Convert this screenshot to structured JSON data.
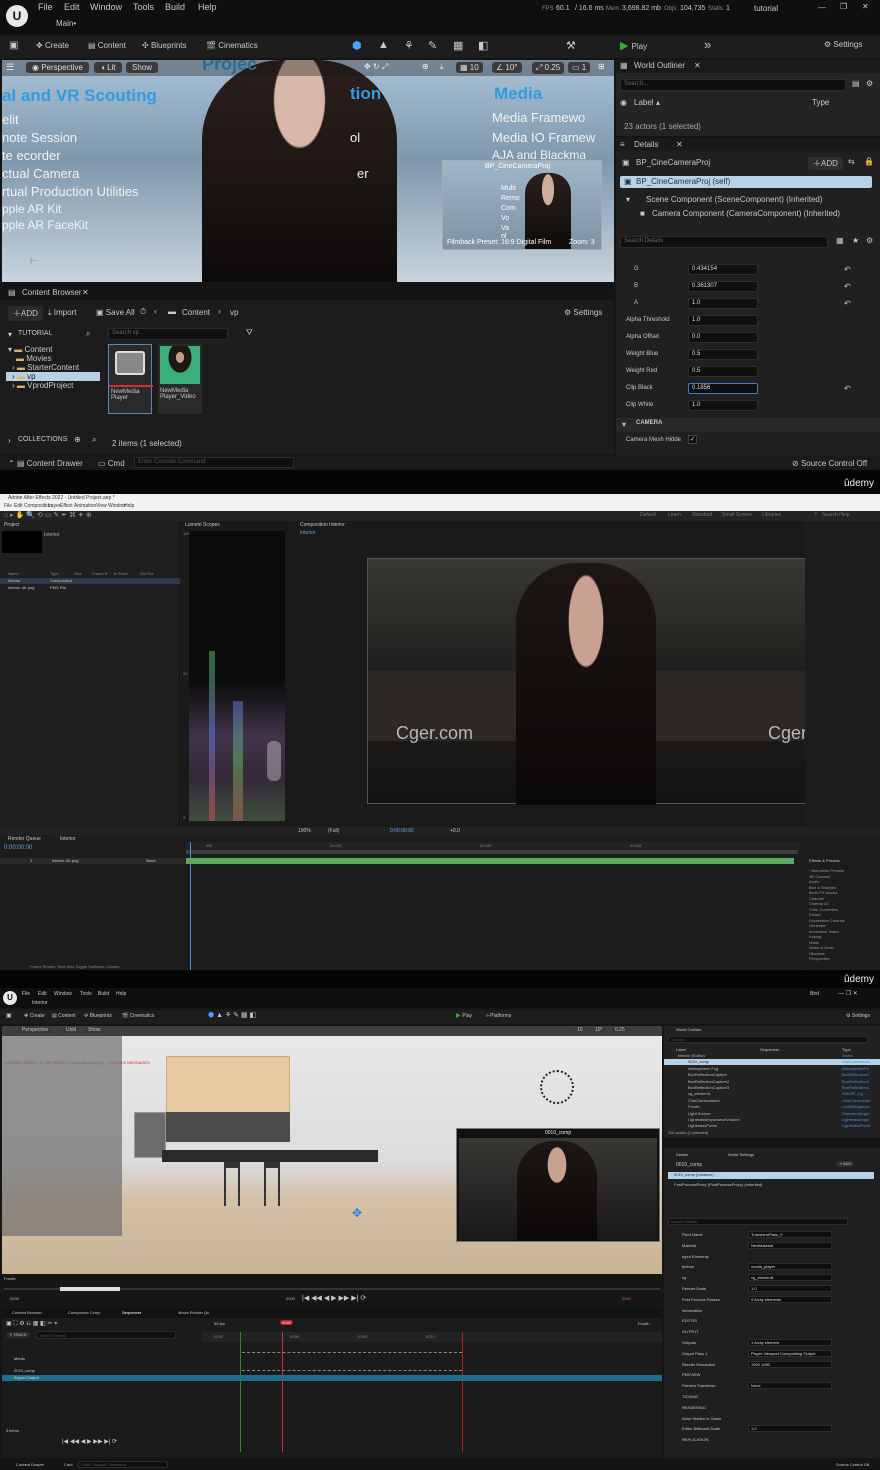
{
  "ue1": {
    "menu": [
      "File",
      "Edit",
      "Window",
      "Tools",
      "Build",
      "Help"
    ],
    "level_tab": "Main•",
    "stats": {
      "fps_label": "FPS",
      "fps": "60.1",
      "ms": "/ 16.6 ms",
      "mem_label": "Mem:",
      "mem": "3,698.82 mb",
      "objs_label": "Objs:",
      "objs": "104,735",
      "stalls_label": "Stalls:",
      "stalls": "1"
    },
    "project": "tutorial",
    "toolbar": {
      "create": "Create",
      "content": "Content",
      "blueprints": "Blueprints",
      "cinematics": "Cinematics",
      "play": "Play",
      "settings": "Settings"
    },
    "viewport": {
      "perspective": "Perspective",
      "lit": "Lit",
      "show": "Show",
      "snap": "10",
      "angle": "10°",
      "scale": "0.25",
      "cam": "1",
      "bg_left": [
        "al and VR Scouting",
        "elit",
        "note Session",
        "te ecorder",
        "ctual Camera",
        "rtual Production Utilities",
        "pple AR Kit",
        "pple AR FaceKit"
      ],
      "bg_top": "Projec",
      "bg_mid_a": "tion",
      "bg_mid_b": "ol",
      "bg_mid_c": "er",
      "bg_right": [
        "Media",
        "Media Framewo",
        "Media IO Framew",
        "AJA and Blackma"
      ],
      "pip_title": "BP_CineCameraProj",
      "pip_lines": [
        "Multi",
        "Remo",
        "Com",
        "Vo",
        "Va",
        "nl"
      ],
      "pip_preset": "Filmback Preset: 16:9 Digital Film",
      "pip_zoom": "Zoom: 3"
    },
    "outliner": {
      "title": "World Outliner",
      "search": "Search...",
      "col_label": "Label",
      "col_type": "Type",
      "count": "23 actors (1 selected)"
    },
    "details": {
      "title": "Details",
      "actor": "BP_CineCameraProj",
      "add": "ADD",
      "self": "BP_CineCameraProj (self)",
      "comp1": "Scene Component (SceneComponent) (Inherited)",
      "comp2": "Camera Component (CameraComponent) (Inherited)",
      "search": "Search Details",
      "props": [
        {
          "label": "G",
          "value": "0.434154"
        },
        {
          "label": "B",
          "value": "0.361307"
        },
        {
          "label": "A",
          "value": "1.0"
        },
        {
          "label": "Alpha Threshold",
          "value": "1.0"
        },
        {
          "label": "Alpha Offset",
          "value": "0.0"
        },
        {
          "label": "Weight Blue",
          "value": "0.5"
        },
        {
          "label": "Weight Red",
          "value": "0.5"
        },
        {
          "label": "Clip Black",
          "value": "0.1856"
        },
        {
          "label": "Clip White",
          "value": "1.0"
        }
      ],
      "section": "CAMERA",
      "camera_mesh": "Camera Mesh Hidde"
    },
    "content_browser": {
      "tab": "Content Browser",
      "add": "ADD",
      "import": "Import",
      "saveall": "Save All",
      "path1": "Content",
      "path2": "vp",
      "settings": "Settings",
      "project": "TUTORIAL",
      "search": "Search vp",
      "tree": [
        "Content",
        "Movies",
        "StarterContent",
        "vp",
        "VprodProject"
      ],
      "assets": [
        {
          "label": "NewMedia Player"
        },
        {
          "label": "NewMedia Player_Video"
        }
      ],
      "collections": "COLLECTIONS",
      "items": "2 items (1 selected)"
    },
    "statusbar": {
      "drawer": "Content Drawer",
      "cmd": "Cmd",
      "console": "Enter Console Command",
      "source": "Source Control Off"
    },
    "watermark": "ûdemy"
  },
  "ae": {
    "title": "Adobe After Effects 2022 - Untitled Project.aep *",
    "menu": [
      "File",
      "Edit",
      "Composition",
      "Layer",
      "Effect",
      "Animation",
      "View",
      "Window",
      "Help"
    ],
    "top_right": [
      "Default",
      "Learn",
      "Standard",
      "Small Screen",
      "Libraries"
    ],
    "search": "Search Help",
    "project_tab": "Project",
    "lumetri_tab": "Lumetri Scopes",
    "comp_tab": "Composition Interior",
    "comp_crumb": "Interior",
    "scope_ticks": [
      "100",
      "90",
      "80",
      "70",
      "60",
      "50",
      "40",
      "30",
      "20",
      "10",
      "0"
    ],
    "project_cols": [
      "Name",
      "Type",
      "Size",
      "Frame R",
      "In Point",
      "Out Poi"
    ],
    "project_rows": [
      {
        "name": "Interior",
        "type": "Composition"
      },
      {
        "name": "Interior-4K.png",
        "type": "PNG File"
      }
    ],
    "viewer_zoom": "100%",
    "viewer_res": "(Full)",
    "viewer_time": "0:00:00:00",
    "viewer_extra": "+0.0",
    "watermark_left": "Cger.com",
    "watermark_right": "Cger.com",
    "timeline_tab": "Interior",
    "render_tab": "Render Queue",
    "timecode": "0:00:00:00",
    "ruler": [
      "05f",
      "10f",
      "15f",
      "20f",
      "01:00f",
      "05f",
      "10f",
      "15f",
      "20f",
      "02:00f",
      "05f",
      "10f",
      "15f",
      "20f",
      "03:00f",
      "05f",
      "10f"
    ],
    "layer": {
      "num": "1",
      "name": "Interior-4K.png",
      "mode": "None"
    },
    "effects_title": "Effects & Presets",
    "effects": [
      "* Animation Presets",
      "3D Channel",
      "Audio",
      "Blur & Sharpen",
      "Boris FX Mocha",
      "Channel",
      "Cinema 4D",
      "Color Correction",
      "Distort",
      "Expression Controls",
      "Generate",
      "Immersive Video",
      "Keying",
      "Matte",
      "Noise & Grain",
      "Obsolete",
      "Perspective"
    ],
    "footer": "Frame Render Time  0ms     Toggle Switches / Modes",
    "watermark": "ûdemy"
  },
  "ue2": {
    "menu": [
      "File",
      "Edit",
      "Window",
      "Tools",
      "Build",
      "Help"
    ],
    "level_tab": "Interior",
    "project": "Bird",
    "toolbar": {
      "create": "Create",
      "content": "Content",
      "blueprints": "Blueprints",
      "cinematics": "Cinematics",
      "play": "Play",
      "platforms": "Platforms",
      "settings": "Settings"
    },
    "viewport": {
      "perspective": "Perspective",
      "lit": "Unlit",
      "show": "Show",
      "warning": "LIGHTING NEEDS TO BE REBUILT (3 unbuilt object(s)) ... DISABLE MESSAGES",
      "pip_title": "0010_comp",
      "snap": "10",
      "angle": "10°",
      "scale": "0.25"
    },
    "transport": {
      "start": "0000",
      "end": "0000",
      "cur": "0000",
      "label": "Fourth"
    },
    "outliner": {
      "title": "World Outliner",
      "search": "Search...",
      "col_label": "Label",
      "col_seq": "Sequencer",
      "col_type": "Type",
      "count": "114 actors (1 selected)",
      "rows": [
        {
          "label": "Interior (Editor)",
          "type": "World"
        },
        {
          "label": "0010_comp",
          "type": "CineCameraAct"
        },
        {
          "label": "Atmospheric Fog",
          "type": "AtmosphericFo"
        },
        {
          "label": "BoxReflectionCapture",
          "type": "BoxReflectionC"
        },
        {
          "label": "BoxReflectionCapture2",
          "type": "BoxReflectionC"
        },
        {
          "label": "BoxReflectionCapture3",
          "type": "BoxReflectionC"
        },
        {
          "label": "cg_element1",
          "type": "Edit BP_Cg"
        },
        {
          "label": "CineCameraActor",
          "type": "CineCameraAct"
        },
        {
          "label": "Fourth",
          "type": "LevelSequence"
        },
        {
          "label": "Light Source",
          "type": "DirectionalLight"
        },
        {
          "label": "LightmassImportanceVolume",
          "type": "LightmassImpo"
        },
        {
          "label": "LightmassPortal",
          "type": "LightmassPorta"
        }
      ]
    },
    "details": {
      "title": "Details",
      "world_settings": "World Settings",
      "actor": "0010_comp",
      "add": "ADD",
      "comp": "0010_comp (Instance)",
      "comp2": "PostProcessProxy (PostProcessProxy) (Inherited)",
      "search": "Search Details",
      "props": [
        {
          "label": "Pivot Name",
          "value": "TransformPass_0"
        },
        {
          "label": "Material",
          "value": "NewMaterial"
        },
        {
          "label": "Input Elements",
          "value": ""
        },
        {
          "label": "texture",
          "value": "media_player"
        },
        {
          "label": "cg",
          "value": "cg_element1"
        },
        {
          "label": "Render Scale",
          "value": "1.0"
        },
        {
          "label": "Post Process Passes",
          "value": "0 Array elements"
        },
        {
          "label": "Information",
          "value": ""
        },
        {
          "label": "EDITOR",
          "value": ""
        },
        {
          "label": "OUTPUT",
          "value": ""
        },
        {
          "label": "Outputs",
          "value": "1 Array element"
        },
        {
          "label": "Output Pass 1",
          "value": "Player Viewport Compositing Output"
        },
        {
          "label": "Render Resolution",
          "value": "1920    1080"
        },
        {
          "label": "PREVIEW",
          "value": ""
        },
        {
          "label": "Preview Transform",
          "value": "None"
        },
        {
          "label": "TICKING",
          "value": ""
        },
        {
          "label": "RENDERING",
          "value": ""
        },
        {
          "label": "Actor Hidden in Game",
          "value": ""
        },
        {
          "label": "Editor Billboard Scale",
          "value": "1.0"
        },
        {
          "label": "REPLICATION",
          "value": ""
        }
      ]
    },
    "tabs": [
      "Content Browser",
      "Composure Comp",
      "Sequencer",
      "Movie Render Qu"
    ],
    "sequencer": {
      "track": "TRACK",
      "search": "Search Tracks",
      "fps": "30 fps",
      "frame": "0040",
      "label": "Fourth",
      "tracks": [
        "Media",
        "0010_comp",
        "Export Output"
      ],
      "items": "4 items",
      "ruler": [
        "0",
        "0030",
        "0060",
        "0090",
        "0120",
        "0150",
        "0180",
        "0210",
        "0240"
      ]
    },
    "statusbar": {
      "drawer": "Content Drawer",
      "cmd": "Cmd",
      "console": "Enter Console Command",
      "source": "Source Control Off"
    }
  }
}
